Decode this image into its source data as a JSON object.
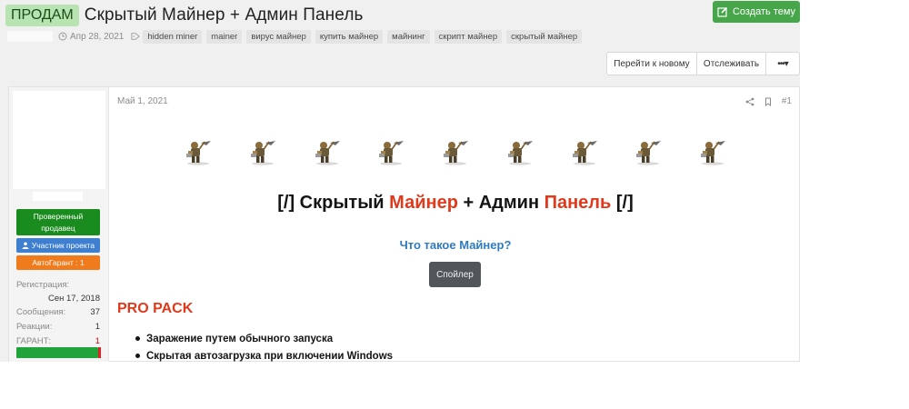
{
  "thread": {
    "prefix": "ПРОДАМ",
    "title": "Скрытый Майнер + Админ Панель",
    "create_button": "Создать тему",
    "date": "Апр 28, 2021",
    "tags": [
      "hidden miner",
      "mainer",
      "вирус майнер",
      "купить майнер",
      "майнинг",
      "скрипт майнер",
      "скрытый майнер"
    ]
  },
  "toolbar": {
    "goto_new": "Перейти к новому",
    "follow": "Отслеживать",
    "more": "•••▾"
  },
  "user": {
    "badge_seller": "Проверенный продавец",
    "badge_member": "Участник проекта",
    "badge_garant": "АвтоГарант : 1",
    "stats": {
      "reg_label": "Регистрация:",
      "reg_value": "Сен 17, 2018",
      "messages_label": "Сообщения:",
      "messages_value": "37",
      "reactions_label": "Реакции:",
      "reactions_value": "1",
      "garant_label": "ГАРАНТ:",
      "garant_value": "1"
    }
  },
  "post": {
    "date": "Май 1, 2021",
    "number": "#1",
    "title_a": "[/] Скрытый ",
    "title_b": "Майнер",
    "title_c": " + Админ ",
    "title_d": "Панель",
    "title_e": " [/]",
    "what_is": "Что такое Майнер?",
    "spoiler": "Спойлер",
    "section": "PRO PACK",
    "features": [
      "Заражение путем обычного запуска",
      "Скрытая автозагрузка при включении Windows"
    ],
    "miner_icons": [
      "miner-icon",
      "miner-icon",
      "miner-icon",
      "miner-icon",
      "miner-icon",
      "miner-icon",
      "miner-icon",
      "miner-icon",
      "miner-icon"
    ]
  },
  "colors": {
    "prefix_bg": "#b7e4b1",
    "create_btn": "#47a54a",
    "seller": "#1a8b1f",
    "member": "#3e7fcf",
    "garant": "#f07b1d",
    "accent_red": "#e0391b",
    "link_blue": "#2e7cc1"
  }
}
